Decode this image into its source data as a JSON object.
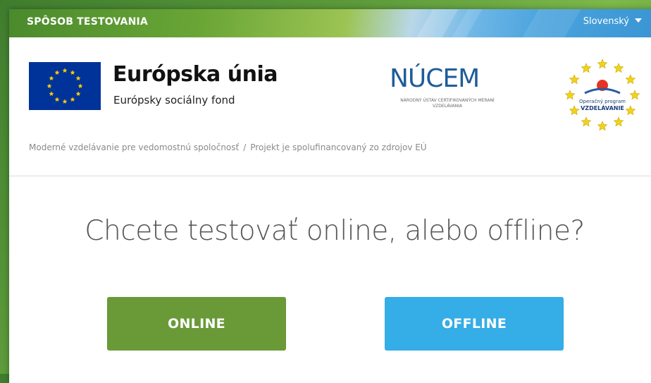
{
  "header": {
    "title": "SPÔSOB TESTOVANIA",
    "language": "Slovenský"
  },
  "logos": {
    "eu_title": "Európska únia",
    "eu_subtitle": "Európsky sociálny fond",
    "nucem_word": "NÚCEM",
    "nucem_subtitle": "NÁRODNÝ ÚSTAV CERTIFIKOVANÝCH MERANÍ VZDELÁVANIA",
    "op_line1": "Operačný program",
    "op_line2": "VZDELÁVANIE"
  },
  "breadcrumb": {
    "left": "Moderné vzdelávanie pre vedomostnú spoločnosť",
    "separator": "/",
    "right": "Projekt je spolufinancovaný zo zdrojov EÚ"
  },
  "main": {
    "question": "Chcete testovať online, alebo offline?",
    "online_label": "ONLINE",
    "offline_label": "OFFLINE"
  },
  "colors": {
    "online_button": "#6a9a38",
    "offline_button": "#35ade6",
    "eu_flag": "#003399",
    "eu_star": "#ffcc00",
    "nucem": "#1f5c9a"
  },
  "icons": {
    "language_caret": "chevron-down-icon",
    "eu_flag": "eu-flag-icon",
    "op_logo": "operacny-program-logo-icon"
  }
}
